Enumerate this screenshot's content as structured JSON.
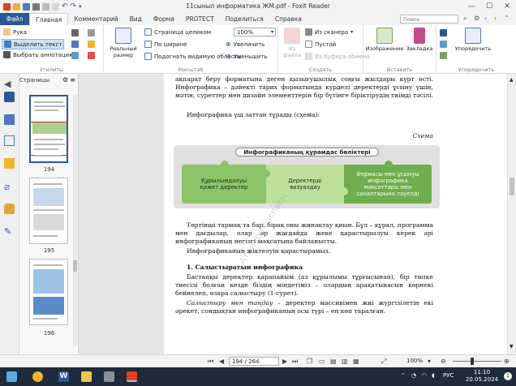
{
  "window": {
    "title": "11сынып  информатика ЖМ.pdf - Foxit Reader",
    "min": "—",
    "max": "☐",
    "close": "✕"
  },
  "menu": {
    "file": "Файл",
    "tabs": [
      "Главная",
      "Комментарий",
      "Вид",
      "Форма",
      "PROTECT",
      "Поделиться",
      "Справка"
    ],
    "search_placeholder": "Поиск"
  },
  "ribbon": {
    "tools": {
      "hand": "Рука",
      "select_text": "Выделить текст",
      "select_annot": "Выбрать аннотацию",
      "label": "Утилиты"
    },
    "view": {
      "actual_size": "Реальный размер",
      "fit_page": "Страница целиком",
      "fit_width": "По ширине",
      "fit_visible": "Подогнать видимую область",
      "zoom_value": "100%",
      "zoom_in": "Увеличить",
      "zoom_out": "Уменьшить",
      "label": "Масштаб"
    },
    "create": {
      "from_file": "Из файла",
      "from_scanner": "Из сканера",
      "blank": "Пустой",
      "from_clipboard": "Из буфера обмена",
      "label": "Создать"
    },
    "insert": {
      "image": "Изображение",
      "bookmark": "Закладка",
      "label": "Вставить"
    },
    "arrange": {
      "arrange": "Упорядочить",
      "label": "Упорядочить"
    }
  },
  "pages_panel": {
    "title": "Страницы",
    "thumbs": [
      "194",
      "195",
      "196"
    ]
  },
  "document": {
    "para1": "ақпарат беру форматына деген қызығушылық соңғы жылдары күрт өсті. Инфографика – дәйекті тарих форматында күрделі деректерді ұсыну үшін, мәтін, суреттер мен дизайн элементтерін бір бүтінге біріктірудің тиімді тәсілі.",
    "para2": "Инфографика үш заттан тұрады (схема):",
    "schema_label": "Схема",
    "infographic_title": "Инфографиканың құрамдас бөліктері",
    "piece1": "Құрылымдалуы қажет деректер",
    "piece2": "Деректерді визуалдау",
    "piece3": "Формасы мен ұсынуы инфографика мақсаттары мен саналтарына тәуелді",
    "para3": "Төртінші тармақ та бар, бірақ оны жинақтау қиын. Бұл – құрал, программа мен дағдылар, олар әр жағдайда жеке қарастырылуы керек әрі инфографиканың негізгі мақсатына байланысты.",
    "para4": "Инфографиканың жіктелуін қарастырамыз.",
    "heading": "1. Салыстыратын инфографика",
    "para5": "Бастапқы деректер қарапайым (аз құрылымы тұрғысынан), бір типке тиесілі болған кезде біздің міндетіміз – олардың арақатынасын көрнекі бейнелеп, өзара салыстыру (1-сурет).",
    "para6_italic": "Салыстыру мен таңдау",
    "para6_rest": " – деректер массивімен жиі жүргізілетін екі әрекет, сондықтан инфографиканың осы түрі – ең көп таралған.",
    "watermark": "Атамұра баспасы"
  },
  "statusbar": {
    "page_field": "194 / 264",
    "zoom": "100%"
  },
  "taskbar": {
    "lang": "РУС",
    "time": "11:10",
    "date": "20.05.2024"
  },
  "colors": {
    "file_tab": "#2b579a",
    "puzzle_dark": "#6fae4c",
    "puzzle_mid": "#8dc46a",
    "puzzle_light": "#bfe09a",
    "taskbar": "#1f2a3a"
  }
}
